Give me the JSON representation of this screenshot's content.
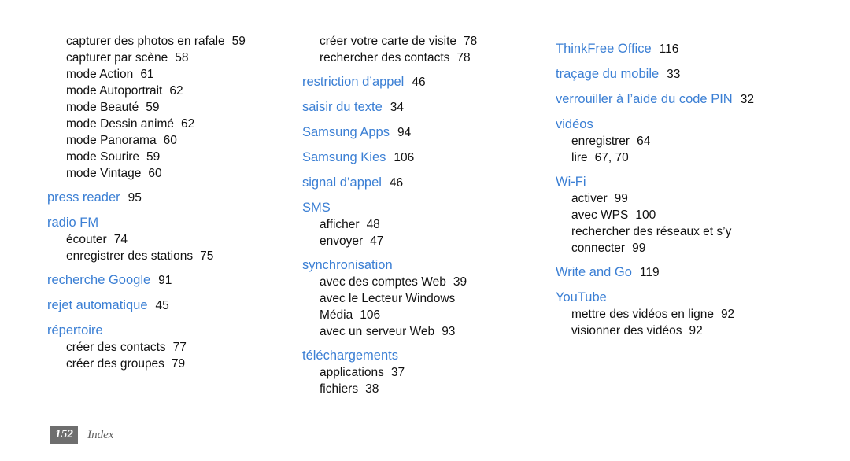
{
  "document": {
    "type": "index",
    "language": "fr",
    "accent_color": "#3b7fd4",
    "text_color": "#111111",
    "background_color": "#ffffff"
  },
  "footer": {
    "page_number": "152",
    "section_label": "Index",
    "badge_background": "#6e6e6e",
    "badge_text_color": "#ffffff",
    "label_color": "#5f5f5f"
  },
  "columns": [
    {
      "id": "column-left",
      "orphan_subs": [
        {
          "label": "capturer des photos en rafale",
          "page": "59"
        },
        {
          "label": "capturer par scène",
          "page": "58"
        },
        {
          "label": "mode Action",
          "page": "61"
        },
        {
          "label": "mode Autoportrait",
          "page": "62"
        },
        {
          "label": "mode Beauté",
          "page": "59"
        },
        {
          "label": "mode Dessin animé",
          "page": "62"
        },
        {
          "label": "mode Panorama",
          "page": "60"
        },
        {
          "label": "mode Sourire",
          "page": "59"
        },
        {
          "label": "mode Vintage",
          "page": "60"
        }
      ],
      "entries": [
        {
          "heading": "press reader",
          "page": "95",
          "subs": []
        },
        {
          "heading": "radio FM",
          "page": "",
          "subs": [
            {
              "label": "écouter",
              "page": "74"
            },
            {
              "label": "enregistrer des stations",
              "page": "75"
            }
          ]
        },
        {
          "heading": "recherche Google",
          "page": "91",
          "subs": []
        },
        {
          "heading": "rejet automatique",
          "page": "45",
          "subs": []
        },
        {
          "heading": "répertoire",
          "page": "",
          "subs": [
            {
              "label": "créer des contacts",
              "page": "77"
            },
            {
              "label": "créer des groupes",
              "page": "79"
            }
          ]
        }
      ]
    },
    {
      "id": "column-middle",
      "orphan_subs": [
        {
          "label": "créer votre carte de visite",
          "page": "78"
        },
        {
          "label": "rechercher des contacts",
          "page": "78"
        }
      ],
      "entries": [
        {
          "heading": "restriction d’appel",
          "page": "46",
          "subs": []
        },
        {
          "heading": "saisir du texte",
          "page": "34",
          "subs": []
        },
        {
          "heading": "Samsung Apps",
          "page": "94",
          "subs": []
        },
        {
          "heading": "Samsung Kies",
          "page": "106",
          "subs": []
        },
        {
          "heading": "signal d’appel",
          "page": "46",
          "subs": []
        },
        {
          "heading": "SMS",
          "page": "",
          "subs": [
            {
              "label": "afficher",
              "page": "48"
            },
            {
              "label": "envoyer",
              "page": "47"
            }
          ]
        },
        {
          "heading": "synchronisation",
          "page": "",
          "subs": [
            {
              "label": "avec des comptes Web",
              "page": "39"
            },
            {
              "label": "avec le Lecteur Windows",
              "page": ""
            },
            {
              "label": "Média",
              "page": "106",
              "continuation": true
            },
            {
              "label": "avec un serveur Web",
              "page": "93"
            }
          ]
        },
        {
          "heading": "téléchargements",
          "page": "",
          "subs": [
            {
              "label": "applications",
              "page": "37"
            },
            {
              "label": "fichiers",
              "page": "38"
            }
          ]
        }
      ]
    },
    {
      "id": "column-right",
      "orphan_subs": [],
      "entries": [
        {
          "heading": "ThinkFree Office",
          "page": "116",
          "subs": []
        },
        {
          "heading": "traçage du mobile",
          "page": "33",
          "subs": []
        },
        {
          "heading": "verrouiller à l’aide du code PIN",
          "page": "32",
          "subs": []
        },
        {
          "heading": "vidéos",
          "page": "",
          "subs": [
            {
              "label": "enregistrer",
              "page": "64"
            },
            {
              "label": "lire",
              "page": "67, 70"
            }
          ]
        },
        {
          "heading": "Wi-Fi",
          "page": "",
          "subs": [
            {
              "label": "activer",
              "page": "99"
            },
            {
              "label": "avec WPS",
              "page": "100"
            },
            {
              "label": "rechercher des réseaux et s’y",
              "page": ""
            },
            {
              "label": "connecter",
              "page": "99",
              "continuation": true
            }
          ]
        },
        {
          "heading": "Write and Go",
          "page": "119",
          "subs": []
        },
        {
          "heading": "YouTube",
          "page": "",
          "subs": [
            {
              "label": "mettre des vidéos en ligne",
              "page": "92"
            },
            {
              "label": "visionner des vidéos",
              "page": "92"
            }
          ]
        }
      ]
    }
  ]
}
